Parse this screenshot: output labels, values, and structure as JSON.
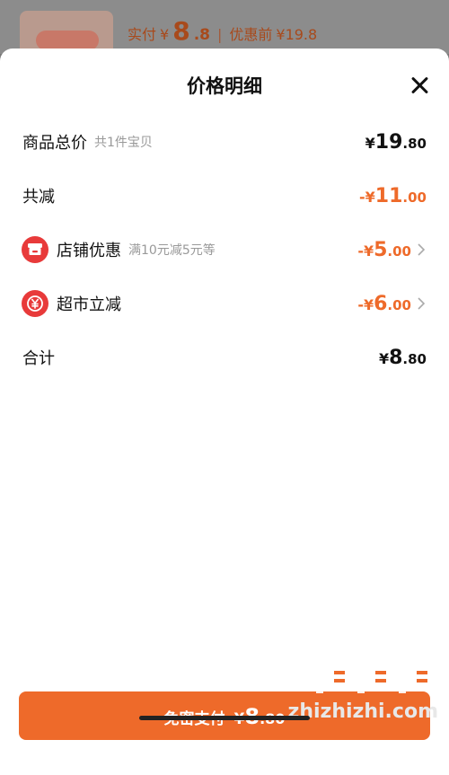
{
  "background": {
    "price_prefix": "实付",
    "price_symbol": "¥",
    "price_int": "8",
    "price_dec": ".8",
    "separator": "|",
    "original_label": "优惠前",
    "original_price": "¥19.8"
  },
  "sheet": {
    "title": "价格明细",
    "close_icon": "close-icon"
  },
  "rows": {
    "total": {
      "label": "商品总价",
      "sub": "共1件宝贝",
      "symbol": "¥",
      "int": "19",
      "dec": ".80"
    },
    "discount": {
      "label": "共减",
      "symbol": "-¥",
      "int": "11",
      "dec": ".00"
    },
    "shop": {
      "icon": "shop-icon",
      "label": "店铺优惠",
      "sub": "满10元减5元等",
      "symbol": "-¥",
      "int": "5",
      "dec": ".00"
    },
    "market": {
      "icon": "yuan-coin-icon",
      "label": "超市立减",
      "symbol": "-¥",
      "int": "6",
      "dec": ".00"
    },
    "sum": {
      "label": "合计",
      "symbol": "¥",
      "int": "8",
      "dec": ".80"
    }
  },
  "pay_button": {
    "label": "免密支付",
    "symbol": "¥",
    "int": "8",
    "dec": ".80"
  },
  "watermark": {
    "text": "zhizhizhi.com"
  },
  "colors": {
    "accent": "#ee6a2a",
    "icon_red": "#e83a3a",
    "text": "#111111",
    "muted": "#999999"
  }
}
